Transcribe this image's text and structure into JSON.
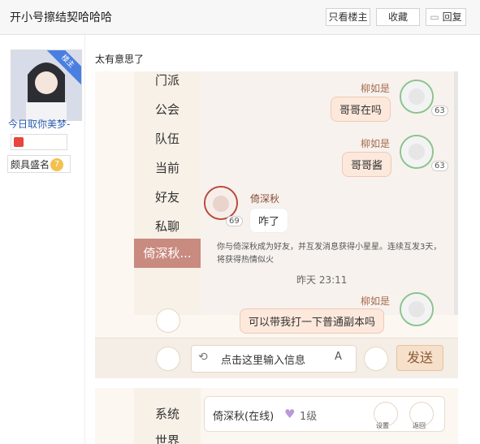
{
  "thread": {
    "title": "开小号擦结契哈哈哈"
  },
  "actions": {
    "only_op": "只看楼主",
    "favorite": "收藏",
    "reply": "回复"
  },
  "author": {
    "username": "今日取你美梦-",
    "rank_title": "颇具盛名",
    "rank_level": "7",
    "op_badge": "楼主"
  },
  "post": {
    "text": "太有意思了"
  },
  "game": {
    "menu": [
      "门派",
      "公会",
      "队伍",
      "当前",
      "好友",
      "私聊",
      "倚深秋..."
    ],
    "messages": [
      {
        "name": "柳如是",
        "text": "哥哥在吗",
        "level": "63"
      },
      {
        "name": "柳如是",
        "text": "哥哥酱",
        "level": "63"
      },
      {
        "name": "倚深秋",
        "text": "咋了",
        "level": "69"
      },
      {
        "name": "柳如是",
        "text": "可以带我打一下普通副本吗"
      }
    ],
    "system_text": "你与倚深秋成为好友，并互发消息获得小星星。连续互发3天，将获得热情似火",
    "time": "昨天 23:11",
    "input_placeholder": "点击这里输入信息",
    "send": "发送"
  },
  "game2": {
    "menu": [
      "系统",
      "世界"
    ],
    "friend_name": "倚深秋(在线)",
    "level": "1级",
    "settings": "设置",
    "back": "返回"
  },
  "colors": {
    "accent": "#2a5db0",
    "active": "#c98a7f"
  }
}
